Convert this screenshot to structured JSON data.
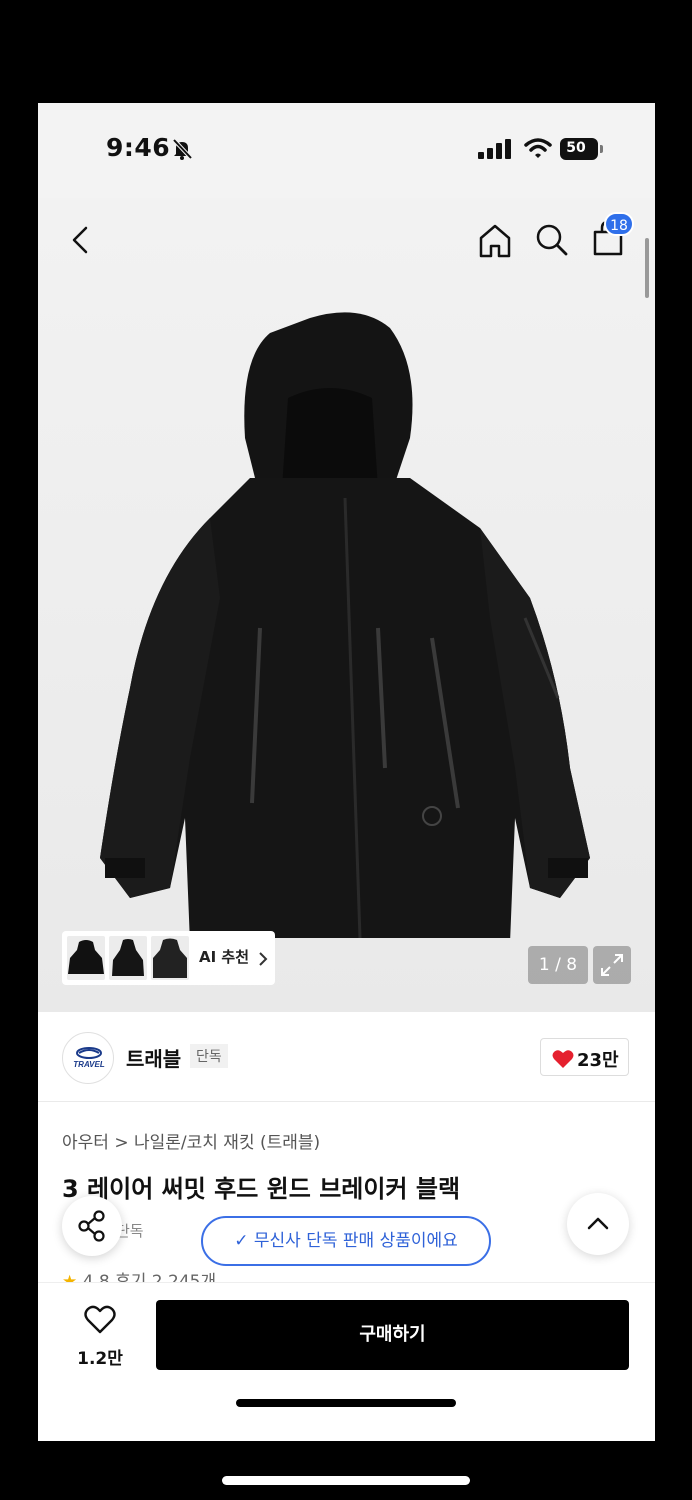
{
  "status_bar": {
    "time": "9:46",
    "battery": "50"
  },
  "nav": {
    "cart_count": "18"
  },
  "image": {
    "page_counter": "1 / 8",
    "ai_label": "AI 추천"
  },
  "brand": {
    "name": "트래블",
    "tag": "단독",
    "logo_text": "TRAVEL",
    "likes": "23만"
  },
  "product": {
    "breadcrumb": "아우터 > 나일론/코치 재킷 (트래블)",
    "title": "3 레이어 써밋 후드 윈드 브레이커 블랙",
    "sub_tag": "단독",
    "rating": "4.8",
    "review_text": "후기 2,245개"
  },
  "toast": {
    "text": "무신사 단독 판매 상품이에요"
  },
  "bottom_bar": {
    "wish_count": "1.2만",
    "buy_label": "구매하기"
  },
  "colors": {
    "accent_blue": "#2f6fea",
    "heart_red": "#e5202e",
    "buy_bg": "#000000"
  }
}
